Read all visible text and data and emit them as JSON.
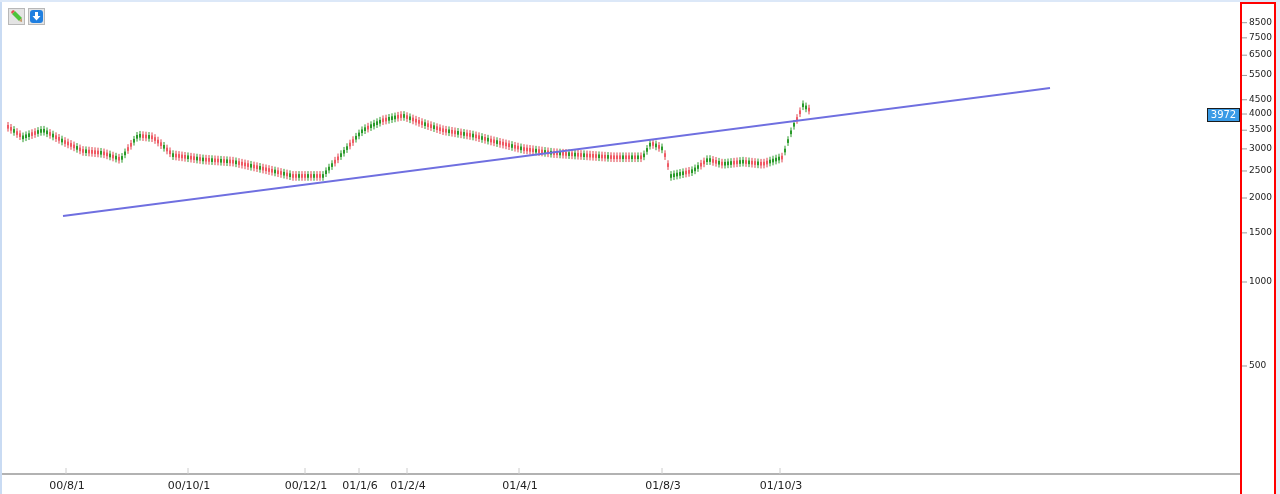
{
  "toolbar": [
    {
      "kind": "pencil"
    },
    {
      "kind": "download"
    }
  ],
  "price_axis": {
    "labels": [
      "8500",
      "7500",
      "6500",
      "5500",
      "4500",
      "4000",
      "3500",
      "3000",
      "2500",
      "2000",
      "1500",
      "1000",
      "500"
    ],
    "current_price": "3972"
  },
  "date_axis": {
    "labels": [
      "00/8/1",
      "00/10/1",
      "00/12/1",
      "01/1/6",
      "01/2/4",
      "01/4/1",
      "01/8/3",
      "01/10/3"
    ]
  }
}
